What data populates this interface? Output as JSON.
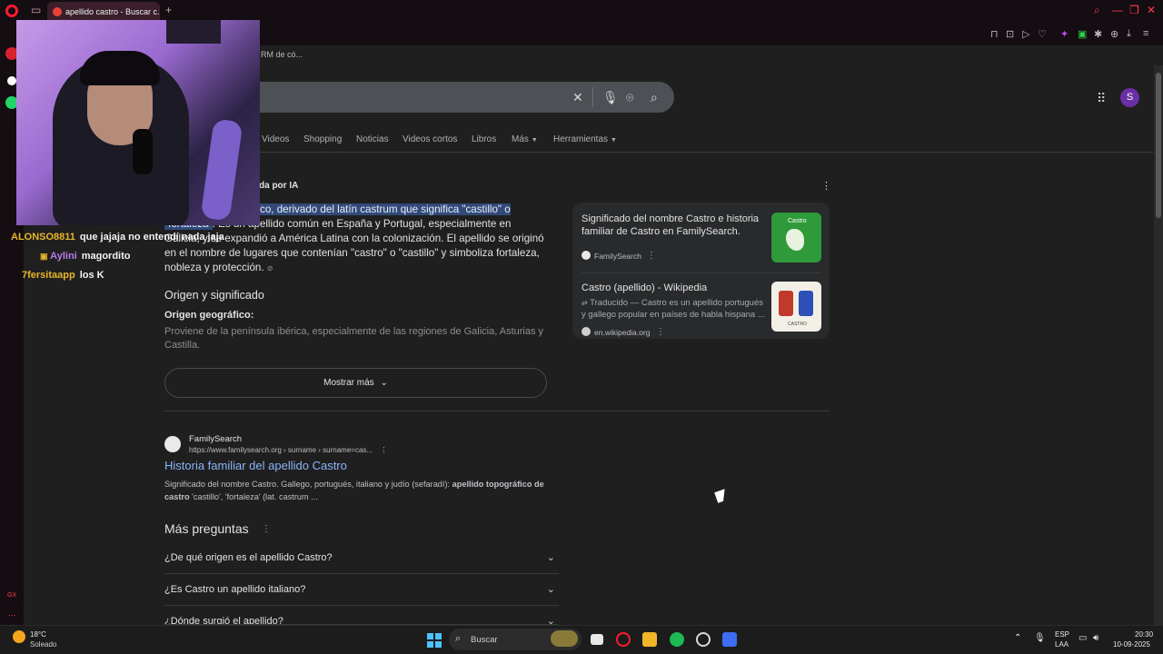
{
  "browser": {
    "tab_title": "apellido castro - Buscar c...",
    "bookmark_text": "RM de có..."
  },
  "search": {
    "query": ""
  },
  "account": {
    "initial": "S"
  },
  "nav_tabs": [
    "Videos",
    "Shopping",
    "Noticias",
    "Videos cortos",
    "Libros",
    "Más",
    "Herramientas"
  ],
  "chat": [
    {
      "user": "ALONSO8811",
      "msg": "que jajaja no entendí nada jaja"
    },
    {
      "user": "Aylini",
      "msg": "magordito"
    },
    {
      "user": "7fersitaapp",
      "msg": "los K"
    }
  ],
  "ai_overview": {
    "label": "da por IA",
    "highlight": "s de origen toponímico, derivado del latín castrum que significa \"castillo\" o \"fortaleza\"",
    "rest": ". Es un apellido común en España y Portugal, especialmente en Galicia, y se expandió a América Latina con la colonización. El apellido se originó en el nombre de lugares que contenían \"castro\" o \"castillo\" y simboliza fortaleza, nobleza y protección.",
    "origin_title": "Origen y significado",
    "origin_geo": "Origen geográfico:",
    "origin_text": "Proviene de la península ibérica, especialmente de las regiones de Galicia, Asturias y Castilla.",
    "show_more": "Mostrar más"
  },
  "side_cards": [
    {
      "title": "Significado del nombre Castro e historia familiar de Castro en FamilySearch.",
      "source": "FamilySearch",
      "thumb_text": "Castro"
    },
    {
      "title": "Castro (apellido) - Wikipedia",
      "snippet": "Traducido — Castro es un apellido portugués y gallego popular en países de habla hispana ...",
      "source": "en.wikipedia.org",
      "thumb_text": "CASTRO"
    }
  ],
  "result": {
    "site": "FamilySearch",
    "url": "https://www.familysearch.org › surname › surname=cas...",
    "title": "Historia familiar del apellido Castro",
    "snippet_pre": "Significado del nombre Castro. Gallego, portugués, italiano y judío (sefaradí): ",
    "snippet_bold": "apellido topográfico de castro",
    "snippet_post": " 'castillo', 'fortaleza' (lat. castrum ..."
  },
  "more_questions": {
    "title": "Más preguntas",
    "items": [
      "¿De qué origen es el apellido Castro?",
      "¿Es Castro un apellido italiano?",
      "¿Dónde surgió el apellido?"
    ]
  },
  "taskbar": {
    "temp": "18°C",
    "weather": "Soleado",
    "search_label": "Buscar",
    "lang": "ESP",
    "lang_sub": "LAA",
    "time": "20:30",
    "date": "10-09-2025"
  },
  "colors": {
    "link": "#8ab4f8",
    "highlight_bg": "#324a78",
    "chat_user": "#e7b52a",
    "opera_red": "#ff1b2d"
  }
}
